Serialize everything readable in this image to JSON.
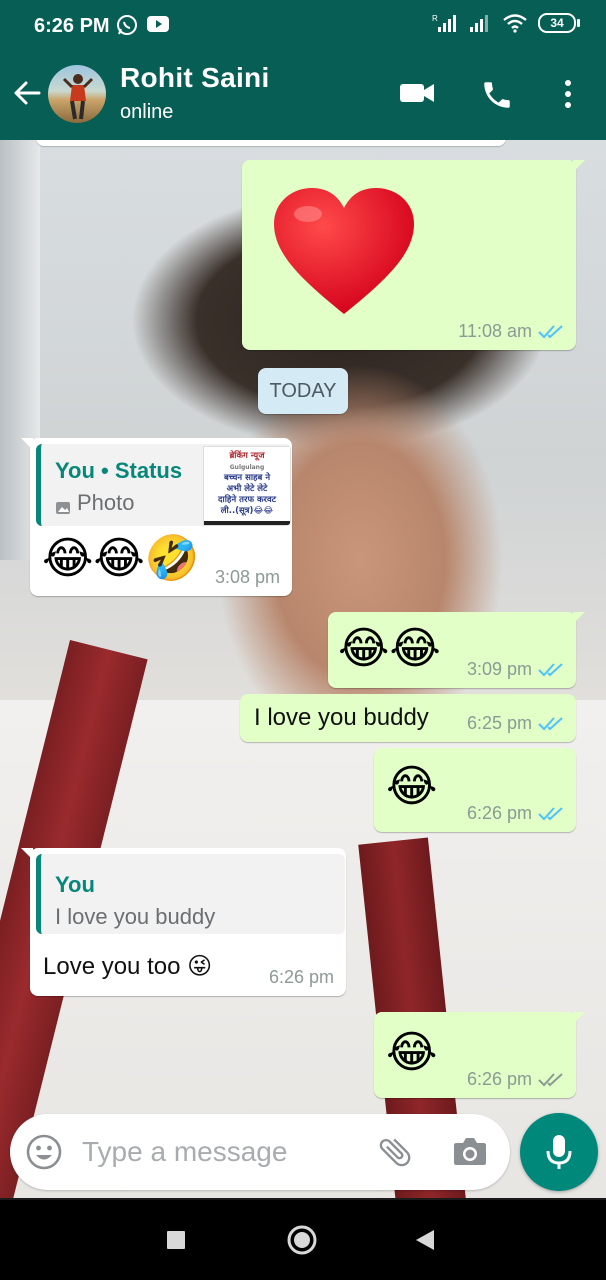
{
  "status_bar": {
    "time": "6:26 PM",
    "battery": "34"
  },
  "header": {
    "contact_name": "Rohit Saini",
    "contact_status": "online"
  },
  "messages": [
    {
      "id": "m1",
      "direction": "outgoing",
      "content": "❤️",
      "time": "11:08 am",
      "ticks": "read"
    },
    {
      "id": "m2",
      "direction": "incoming",
      "reply_to": {
        "sender": "You • Status",
        "preview": "Photo"
      },
      "content": "😂😂🤣",
      "time": "3:08 pm",
      "status_thumbnail_text": [
        "ब्रेकिंग न्यूज",
        "Gulgulang",
        "बच्चन साहब ने",
        "अभी लेटे लेटे",
        "दाहिने तरफ करवट",
        "ली..(सूत्र)😂😂"
      ]
    },
    {
      "id": "m3",
      "direction": "outgoing",
      "content": "😂😂",
      "time": "3:09 pm",
      "ticks": "read"
    },
    {
      "id": "m4",
      "direction": "outgoing",
      "content": "I love you buddy",
      "time": "6:25 pm",
      "ticks": "read"
    },
    {
      "id": "m5",
      "direction": "outgoing",
      "content": "😂",
      "time": "6:26 pm",
      "ticks": "read"
    },
    {
      "id": "m6",
      "direction": "incoming",
      "reply_to": {
        "sender": "You",
        "preview": "I love you buddy"
      },
      "content": "Love you too 😜",
      "time": "6:26 pm"
    },
    {
      "id": "m7",
      "direction": "outgoing",
      "content": "😂",
      "time": "6:26 pm",
      "ticks": "delivered"
    }
  ],
  "date_divider": "TODAY",
  "composer": {
    "placeholder": "Type a message"
  },
  "colors": {
    "header": "#075e54",
    "outgoing_bubble": "#e1ffc7",
    "incoming_bubble": "#ffffff",
    "read_tick": "#4fc3f7",
    "mic_button": "#00897b"
  }
}
